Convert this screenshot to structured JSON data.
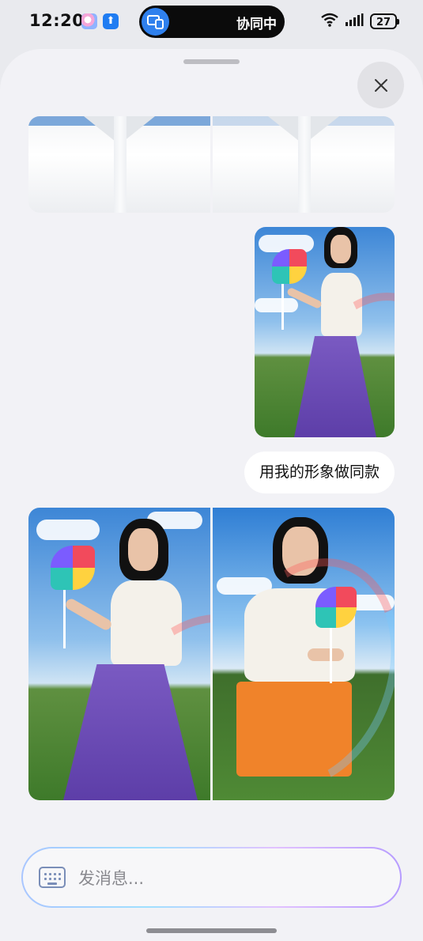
{
  "status_bar": {
    "time": "12:20",
    "island_label": "协同中",
    "battery": "27"
  },
  "chat": {
    "user_message": "用我的形象做同款",
    "input_placeholder": "发消息..."
  },
  "icons": {
    "close": "close-icon",
    "keyboard": "keyboard-icon",
    "wifi": "wifi-icon",
    "signal": "signal-icon",
    "screen_share": "screen-share-icon"
  }
}
